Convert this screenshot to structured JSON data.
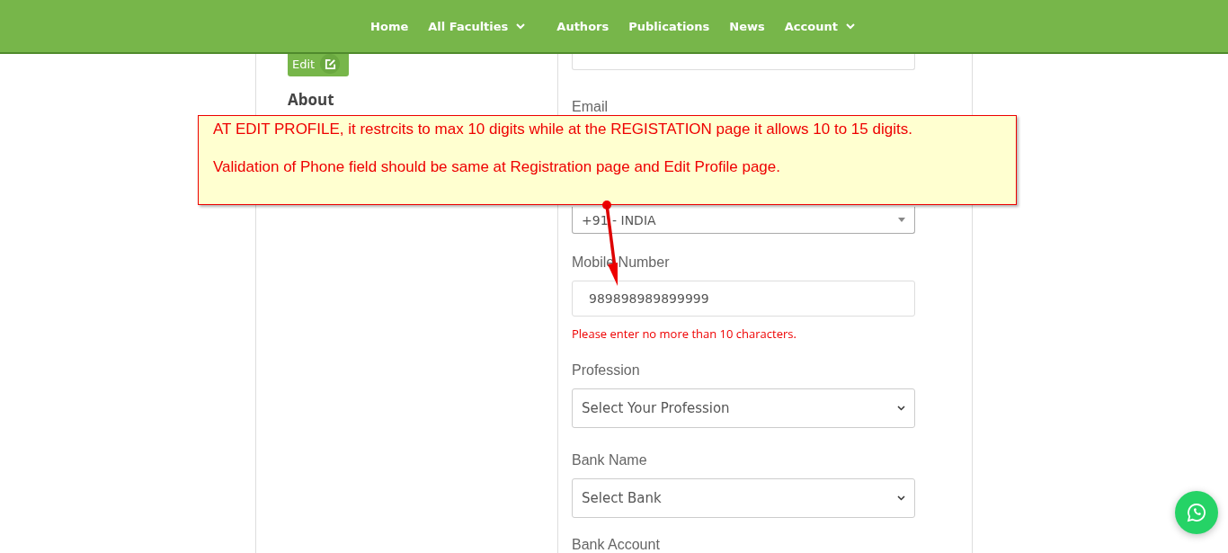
{
  "nav": {
    "items": [
      {
        "label": "Home",
        "dropdown": false
      },
      {
        "label": "All Faculties",
        "dropdown": true
      },
      {
        "label": "Authors",
        "dropdown": false
      },
      {
        "label": "Publications",
        "dropdown": false
      },
      {
        "label": "News",
        "dropdown": false
      },
      {
        "label": "Account",
        "dropdown": true
      }
    ]
  },
  "sidebar": {
    "edit_button": "Edit",
    "heading": "About"
  },
  "form": {
    "email_label": "Email",
    "country_value": "+91 - INDIA",
    "mobile_label": "Mobile Number",
    "mobile_value": "989898989899999",
    "mobile_error": "Please enter no more than 10 characters.",
    "profession_label": "Profession",
    "profession_value": "Select Your Profession",
    "bank_label": "Bank Name",
    "bank_value": "Select Bank",
    "account_label": "Bank Account"
  },
  "annotation": {
    "lines": [
      "AT EDIT PROFILE, it restrcits to max 10 digits while at the REGISTATION page it allows 10 to 15 digits.",
      "Validation of Phone field should be same at Registration page and Edit Profile page."
    ]
  }
}
